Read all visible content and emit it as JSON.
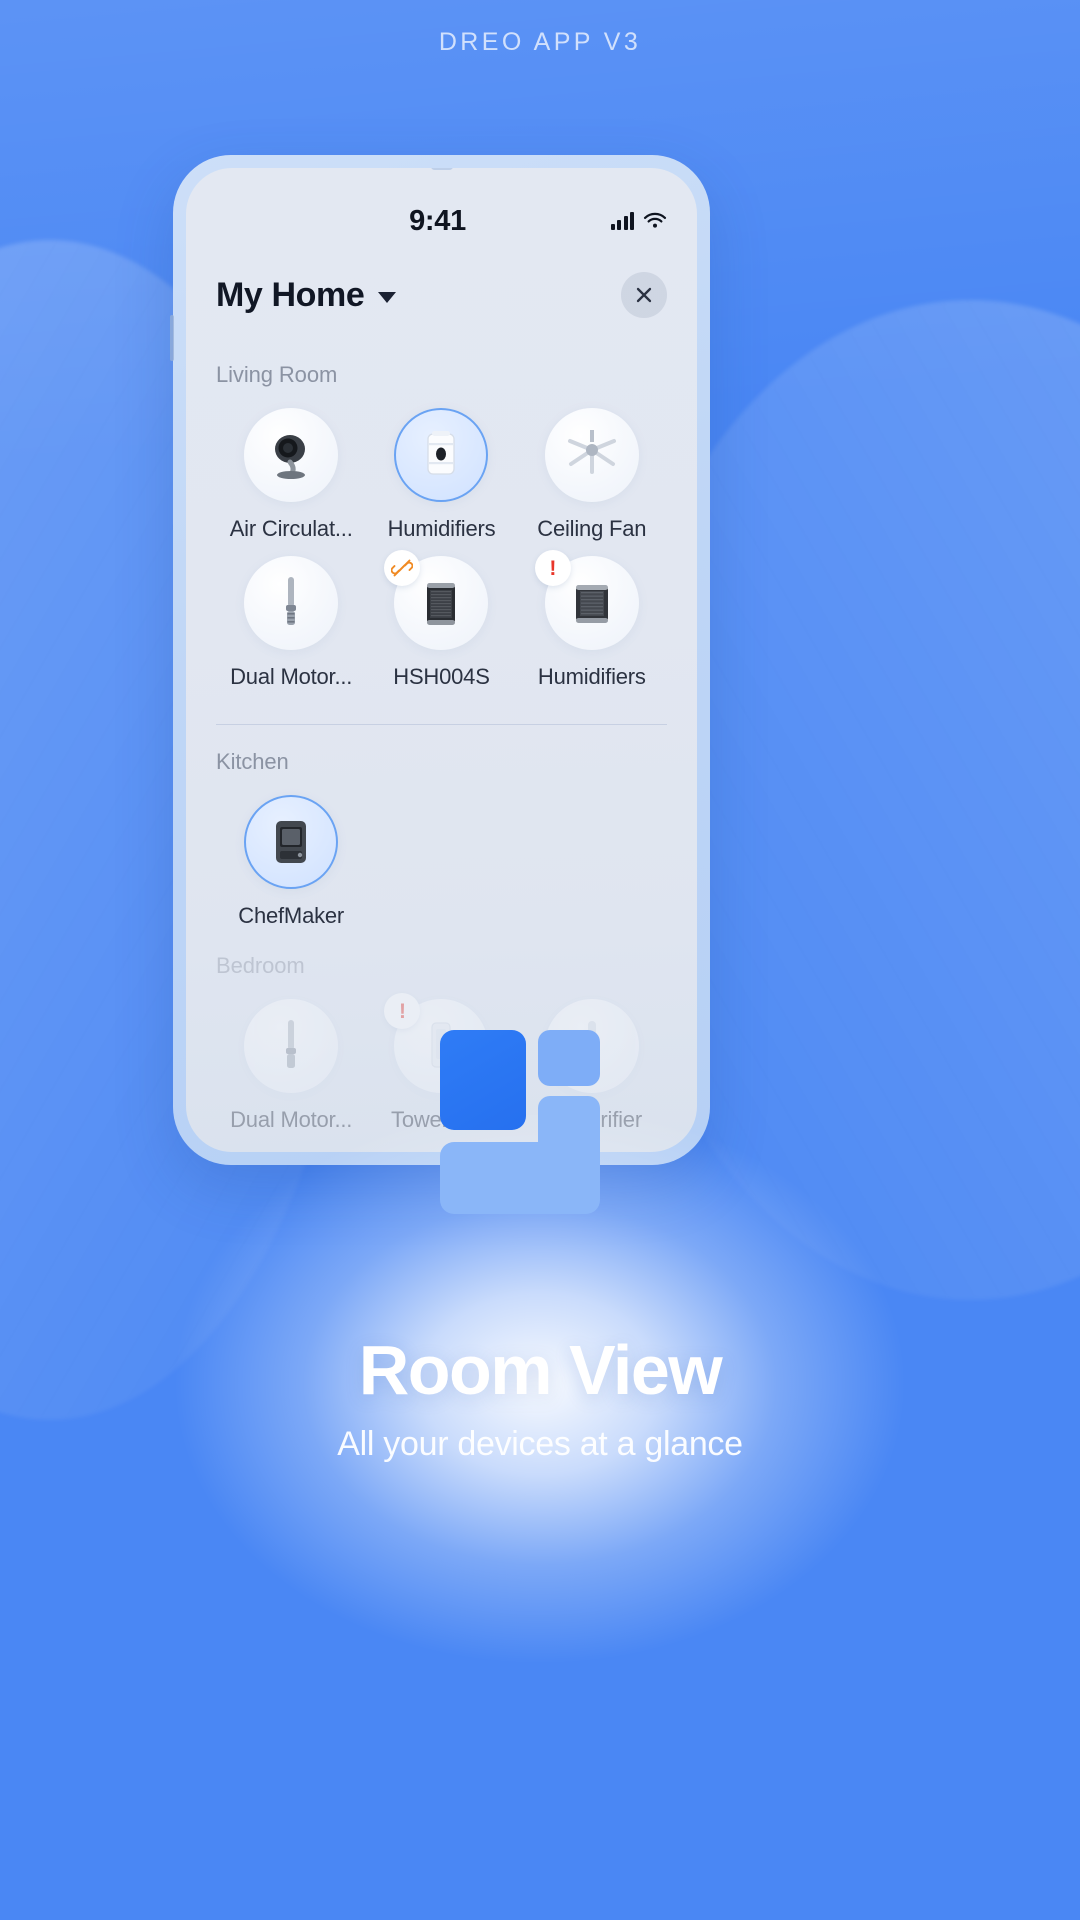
{
  "top_caption": "DREO APP V3",
  "status_bar": {
    "time": "9:41",
    "signal_icon": "cellular-signal-icon",
    "wifi_icon": "wifi-icon"
  },
  "app_header": {
    "home_name": "My Home",
    "dropdown_icon": "chevron-down-icon",
    "close_icon": "close-icon"
  },
  "rooms": [
    {
      "name": "Living Room",
      "devices": [
        {
          "label": "Air Circulat...",
          "icon": "air-circulator-icon",
          "state": "normal",
          "badge": ""
        },
        {
          "label": "Humidifiers",
          "icon": "humidifier-icon",
          "state": "active",
          "badge": ""
        },
        {
          "label": "Ceiling Fan",
          "icon": "ceiling-fan-icon",
          "state": "normal",
          "badge": ""
        },
        {
          "label": "Dual Motor...",
          "icon": "tower-fan-icon",
          "state": "normal",
          "badge": ""
        },
        {
          "label": "HSH004S",
          "icon": "heater-icon",
          "state": "normal",
          "badge": "offline"
        },
        {
          "label": "Humidifiers",
          "icon": "air-purifier-icon",
          "state": "normal",
          "badge": "alert"
        }
      ]
    },
    {
      "name": "Kitchen",
      "devices": [
        {
          "label": "ChefMaker",
          "icon": "chefmaker-icon",
          "state": "active",
          "badge": ""
        }
      ]
    },
    {
      "name": "Bedroom",
      "devices": [
        {
          "label": "Dual Motor...",
          "icon": "tower-fan-icon",
          "state": "normal",
          "badge": ""
        },
        {
          "label": "Tower Fan",
          "icon": "tower-heater-icon",
          "state": "normal",
          "badge": "alert"
        },
        {
          "label": "Air Purifier",
          "icon": "slim-fan-icon",
          "state": "normal",
          "badge": ""
        }
      ]
    }
  ],
  "footer": {
    "headline": "Room View",
    "subhead": "All your devices at a glance",
    "logo_icon": "room-layout-logo-icon"
  },
  "colors": {
    "accent": "#2f7cf6",
    "background": "#4a87f4",
    "alert": "#e8362a",
    "offline": "#f08a23",
    "active_ring": "#6aa3f3"
  }
}
